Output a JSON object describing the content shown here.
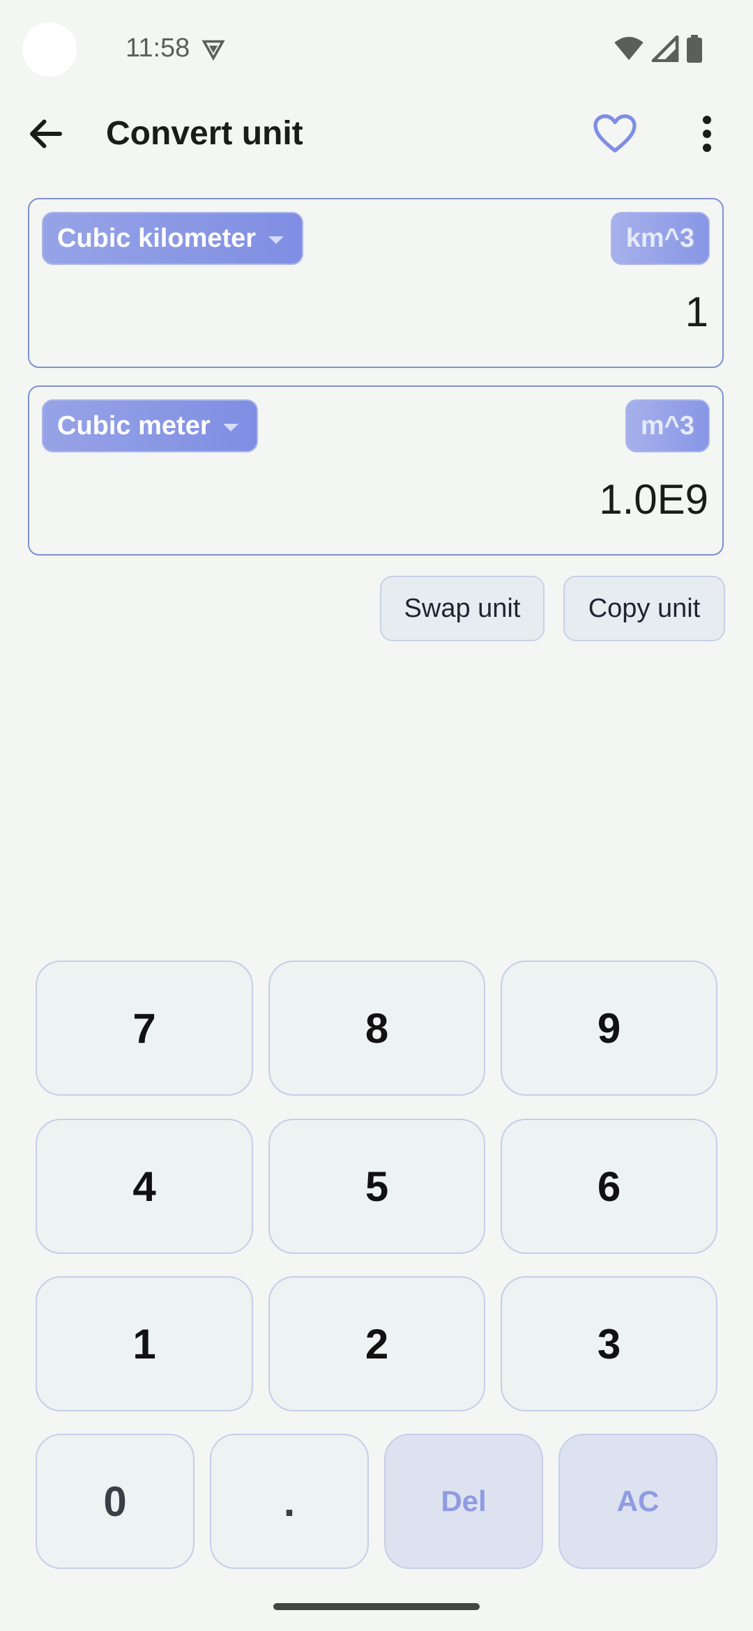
{
  "status_bar": {
    "time": "11:58"
  },
  "app_bar": {
    "title": "Convert unit"
  },
  "from_unit": {
    "name": "Cubic kilometer",
    "symbol": "km^3",
    "value": "1"
  },
  "to_unit": {
    "name": "Cubic meter",
    "symbol": "m^3",
    "value": "1.0E9"
  },
  "actions": {
    "swap_label": "Swap unit",
    "copy_label": "Copy unit"
  },
  "keypad": {
    "k7": "7",
    "k8": "8",
    "k9": "9",
    "k4": "4",
    "k5": "5",
    "k6": "6",
    "k1": "1",
    "k2": "2",
    "k3": "3",
    "k0": "0",
    "dot": ".",
    "del": "Del",
    "ac": "AC"
  },
  "colors": {
    "accent": "#7f8ee3",
    "background": "#f3f6f2",
    "key_background": "#edf2f2",
    "card_border": "#7e8fd6"
  },
  "icons": [
    "back-arrow-icon",
    "heart-icon",
    "more-vert-icon",
    "vpn-key-icon",
    "wifi-icon",
    "signal-icon",
    "battery-icon",
    "dropdown-caret-icon"
  ]
}
